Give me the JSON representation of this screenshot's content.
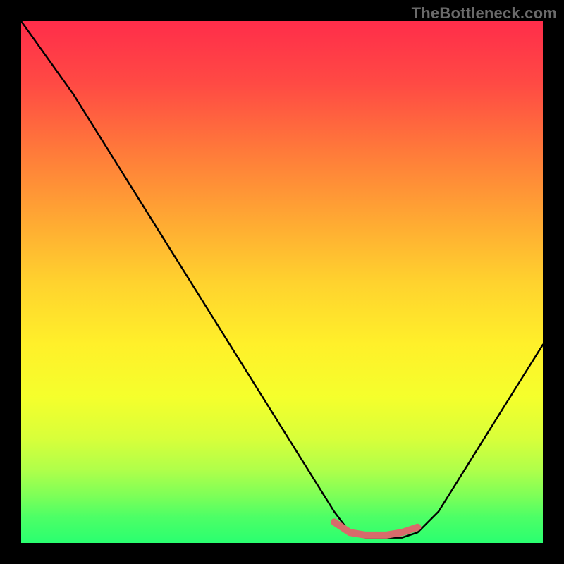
{
  "watermark": "TheBottleneck.com",
  "chart_data": {
    "type": "line",
    "title": "",
    "xlabel": "",
    "ylabel": "",
    "xlim": [
      0,
      100
    ],
    "ylim": [
      0,
      100
    ],
    "grid": false,
    "legend": false,
    "series": [
      {
        "name": "main-curve",
        "color": "#000000",
        "x": [
          0,
          5,
          10,
          15,
          20,
          25,
          30,
          35,
          40,
          45,
          50,
          55,
          60,
          63,
          66,
          70,
          73,
          76,
          80,
          85,
          90,
          95,
          100
        ],
        "y": [
          100,
          93,
          86,
          78,
          70,
          62,
          54,
          46,
          38,
          30,
          22,
          14,
          6,
          2,
          1,
          1,
          1,
          2,
          6,
          14,
          22,
          30,
          38
        ]
      },
      {
        "name": "highlight",
        "color": "#d86b6b",
        "x": [
          60,
          63,
          66,
          70,
          73,
          76
        ],
        "y": [
          4,
          2,
          1.5,
          1.5,
          2,
          3
        ]
      }
    ]
  },
  "colors": {
    "gradient_top": "#ff2d4a",
    "gradient_bottom": "#2aff70",
    "curve": "#000000",
    "highlight": "#d86b6b",
    "background": "#000000",
    "watermark": "#6a6a6a"
  }
}
